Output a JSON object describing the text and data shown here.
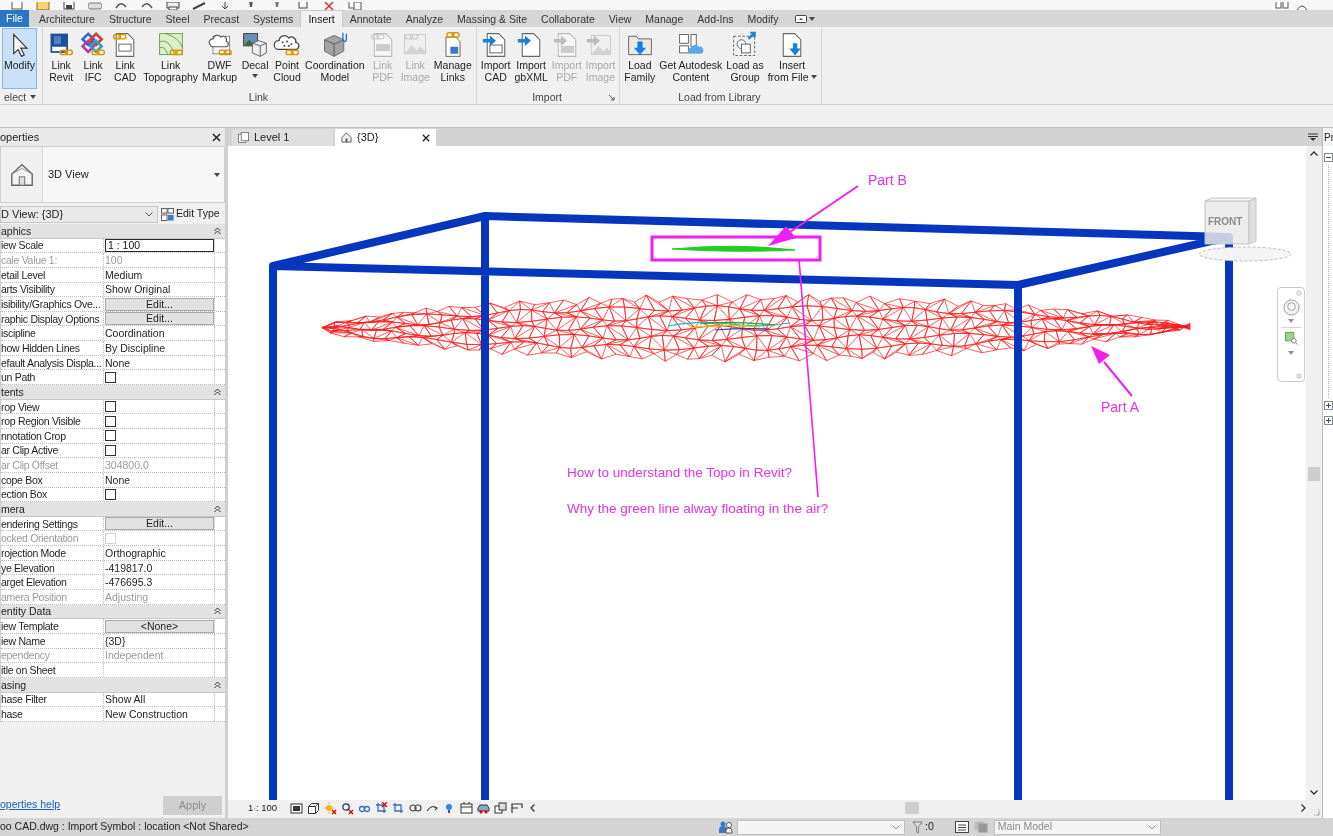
{
  "ribbon": {
    "tabs": [
      {
        "kind": "file",
        "label": "File",
        "selected": false
      },
      {
        "kind": "tab",
        "label": "Architecture",
        "selected": false
      },
      {
        "kind": "tab",
        "label": "Structure",
        "selected": false
      },
      {
        "kind": "tab",
        "label": "Steel",
        "selected": false
      },
      {
        "kind": "tab",
        "label": "Precast",
        "selected": false
      },
      {
        "kind": "tab",
        "label": "Systems",
        "selected": false
      },
      {
        "kind": "tab",
        "label": "Insert",
        "selected": true
      },
      {
        "kind": "tab",
        "label": "Annotate",
        "selected": false
      },
      {
        "kind": "tab",
        "label": "Analyze",
        "selected": false
      },
      {
        "kind": "tab",
        "label": "Massing & Site",
        "selected": false
      },
      {
        "kind": "tab",
        "label": "Collaborate",
        "selected": false
      },
      {
        "kind": "tab",
        "label": "View",
        "selected": false
      },
      {
        "kind": "tab",
        "label": "Manage",
        "selected": false
      },
      {
        "kind": "tab",
        "label": "Add-Ins",
        "selected": false
      },
      {
        "kind": "tab",
        "label": "Modify",
        "selected": false
      },
      {
        "kind": "menu",
        "selected": false
      }
    ],
    "panels": [
      {
        "title": "elect",
        "title_caret": true,
        "buttons": [
          {
            "lines": [
              "Modify"
            ],
            "active": true,
            "disabled": false
          }
        ]
      },
      {
        "title": "Link",
        "buttons": [
          {
            "lines": [
              "Link",
              "Revit"
            ],
            "disabled": false
          },
          {
            "lines": [
              "Link",
              "IFC"
            ],
            "disabled": false
          },
          {
            "lines": [
              "Link",
              "CAD"
            ],
            "disabled": false
          },
          {
            "lines": [
              "Link",
              "Topography"
            ],
            "disabled": false
          },
          {
            "lines": [
              "DWF",
              "Markup"
            ],
            "disabled": false
          },
          {
            "lines": [
              "Decal"
            ],
            "caret": true,
            "disabled": false
          },
          {
            "lines": [
              "Point",
              "Cloud"
            ],
            "disabled": false
          },
          {
            "lines": [
              "Coordination",
              "Model"
            ],
            "disabled": false
          },
          {
            "lines": [
              "Link",
              "PDF"
            ],
            "disabled": true
          },
          {
            "lines": [
              "Link",
              "Image"
            ],
            "disabled": true
          },
          {
            "lines": [
              "Manage",
              "Links"
            ],
            "disabled": false
          }
        ]
      },
      {
        "title": "Import",
        "dialog_launcher": true,
        "buttons": [
          {
            "lines": [
              "Import",
              "CAD"
            ],
            "disabled": false
          },
          {
            "lines": [
              "Import",
              "gbXML"
            ],
            "disabled": false
          },
          {
            "lines": [
              "Import",
              "PDF"
            ],
            "disabled": true
          },
          {
            "lines": [
              "Import",
              "Image"
            ],
            "disabled": true
          }
        ]
      },
      {
        "title": "Load from Library",
        "buttons": [
          {
            "lines": [
              "Load",
              "Family"
            ],
            "disabled": false
          },
          {
            "lines": [
              "Get Autodesk",
              "Content"
            ],
            "disabled": false
          },
          {
            "lines": [
              "Load as",
              "Group"
            ],
            "disabled": false
          },
          {
            "lines": [
              "Insert",
              "from File"
            ],
            "caret": true,
            "disabled": false
          }
        ]
      }
    ]
  },
  "properties": {
    "title": "operties",
    "type_name": "3D View",
    "instance": "D View: {3D}",
    "edit_type": "Edit Type",
    "groups": [
      {
        "title": "aphics",
        "expanded": true,
        "rows": [
          {
            "label": "iew Scale",
            "kind": "input",
            "value": "1 : 100",
            "disabled": false
          },
          {
            "label": "cale Value 1:",
            "kind": "text",
            "value": "100",
            "disabled": true
          },
          {
            "label": "etail Level",
            "kind": "text",
            "value": "Medium",
            "disabled": false
          },
          {
            "label": "arts Visibility",
            "kind": "text",
            "value": "Show Original",
            "disabled": false
          },
          {
            "label": "isibility/Graphics Ove...",
            "kind": "button",
            "value": "Edit...",
            "disabled": false
          },
          {
            "label": "raphic Display Options",
            "kind": "button",
            "value": "Edit...",
            "disabled": false
          },
          {
            "label": "iscipline",
            "kind": "text",
            "value": "Coordination",
            "disabled": false
          },
          {
            "label": "how Hidden Lines",
            "kind": "text",
            "value": "By Discipline",
            "disabled": false
          },
          {
            "label": "efault Analysis Displa...",
            "kind": "text",
            "value": "None",
            "disabled": false
          },
          {
            "label": "un Path",
            "kind": "checkbox",
            "checked": false,
            "disabled": false
          }
        ]
      },
      {
        "title": "tents",
        "expanded": true,
        "rows": [
          {
            "label": "rop View",
            "kind": "checkbox",
            "checked": false,
            "disabled": false
          },
          {
            "label": "rop Region Visible",
            "kind": "checkbox",
            "checked": false,
            "disabled": false
          },
          {
            "label": "nnotation Crop",
            "kind": "checkbox",
            "checked": false,
            "disabled": false
          },
          {
            "label": "ar Clip Active",
            "kind": "checkbox",
            "checked": false,
            "disabled": false
          },
          {
            "label": "ar Clip Offset",
            "kind": "text",
            "value": "304800.0",
            "disabled": true
          },
          {
            "label": "cope Box",
            "kind": "text",
            "value": "None",
            "disabled": false
          },
          {
            "label": "ection Box",
            "kind": "checkbox",
            "checked": false,
            "disabled": false
          }
        ]
      },
      {
        "title": "mera",
        "expanded": true,
        "rows": [
          {
            "label": "endering Settings",
            "kind": "button",
            "value": "Edit...",
            "disabled": false
          },
          {
            "label": "ocked Orientation",
            "kind": "checkbox",
            "checked": false,
            "disabled": true
          },
          {
            "label": "rojection Mode",
            "kind": "text",
            "value": "Orthographic",
            "disabled": false
          },
          {
            "label": "ye Elevation",
            "kind": "text",
            "value": "-419817.0",
            "disabled": false
          },
          {
            "label": "arget Elevation",
            "kind": "text",
            "value": "-476695.3",
            "disabled": false
          },
          {
            "label": "amera Position",
            "kind": "text",
            "value": "Adjusting",
            "disabled": true
          }
        ]
      },
      {
        "title": "entity Data",
        "expanded": true,
        "rows": [
          {
            "label": "iew Template",
            "kind": "button",
            "value": "<None>",
            "disabled": false
          },
          {
            "label": "iew Name",
            "kind": "text",
            "value": "{3D}",
            "disabled": false
          },
          {
            "label": "ependency",
            "kind": "text",
            "value": "Independent",
            "disabled": true
          },
          {
            "label": "itle on Sheet",
            "kind": "text",
            "disabled": false
          }
        ]
      },
      {
        "title": "asing",
        "expanded": true,
        "rows": [
          {
            "label": "hase Filter",
            "kind": "text",
            "value": "Show All",
            "disabled": false
          },
          {
            "label": "hase",
            "kind": "text",
            "value": "New Construction",
            "disabled": false
          }
        ]
      }
    ],
    "help_link": "operties help",
    "apply": {
      "label": "Apply",
      "disabled": true
    }
  },
  "view_tabs": [
    {
      "label": "Level 1",
      "selected": false
    },
    {
      "label": "{3D}",
      "selected": true
    }
  ],
  "viewport": {
    "viewcube": "FRONT",
    "labels": [
      "Part B",
      "Part A"
    ],
    "notes": [
      "How to understand the Topo in Revit?",
      "Why the green line alway floating in the air?"
    ],
    "scale": "1 : 100"
  },
  "browser": {
    "title": "Pr",
    "nodes": [
      {
        "expanded": true
      },
      {
        "expanded": false
      },
      {
        "expanded": false
      }
    ]
  },
  "status_bar": {
    "message": "oo CAD.dwg : Import Symbol : location <Not Shared>",
    "filter_count": ":0",
    "model": "Main Model"
  }
}
